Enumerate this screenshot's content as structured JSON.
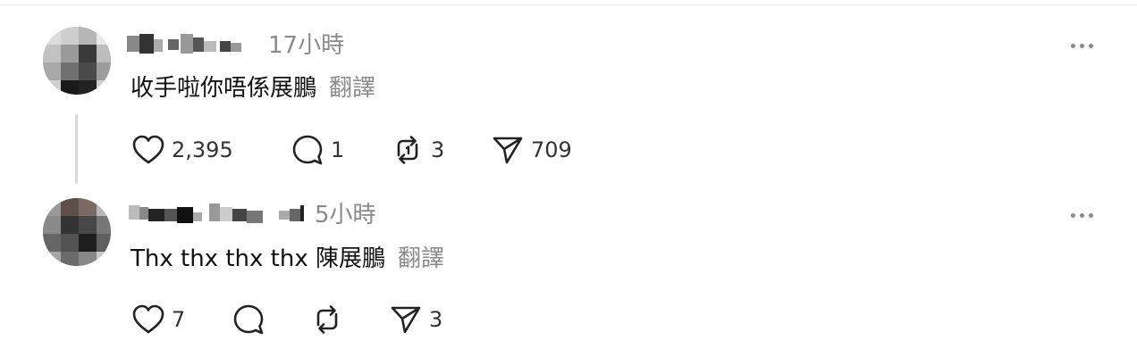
{
  "comments": [
    {
      "timestamp": "17小時",
      "text": "收手啦你唔係展鵬",
      "translate_label": "翻譯",
      "actions": {
        "like_count": "2,395",
        "reply_count": "1",
        "repost_count": "3",
        "share_count": "709"
      }
    },
    {
      "timestamp": "5小時",
      "text": "Thx thx thx thx 陳展鵬",
      "translate_label": "翻譯",
      "actions": {
        "like_count": "7",
        "reply_count": "",
        "repost_count": "",
        "share_count": "3"
      }
    }
  ]
}
